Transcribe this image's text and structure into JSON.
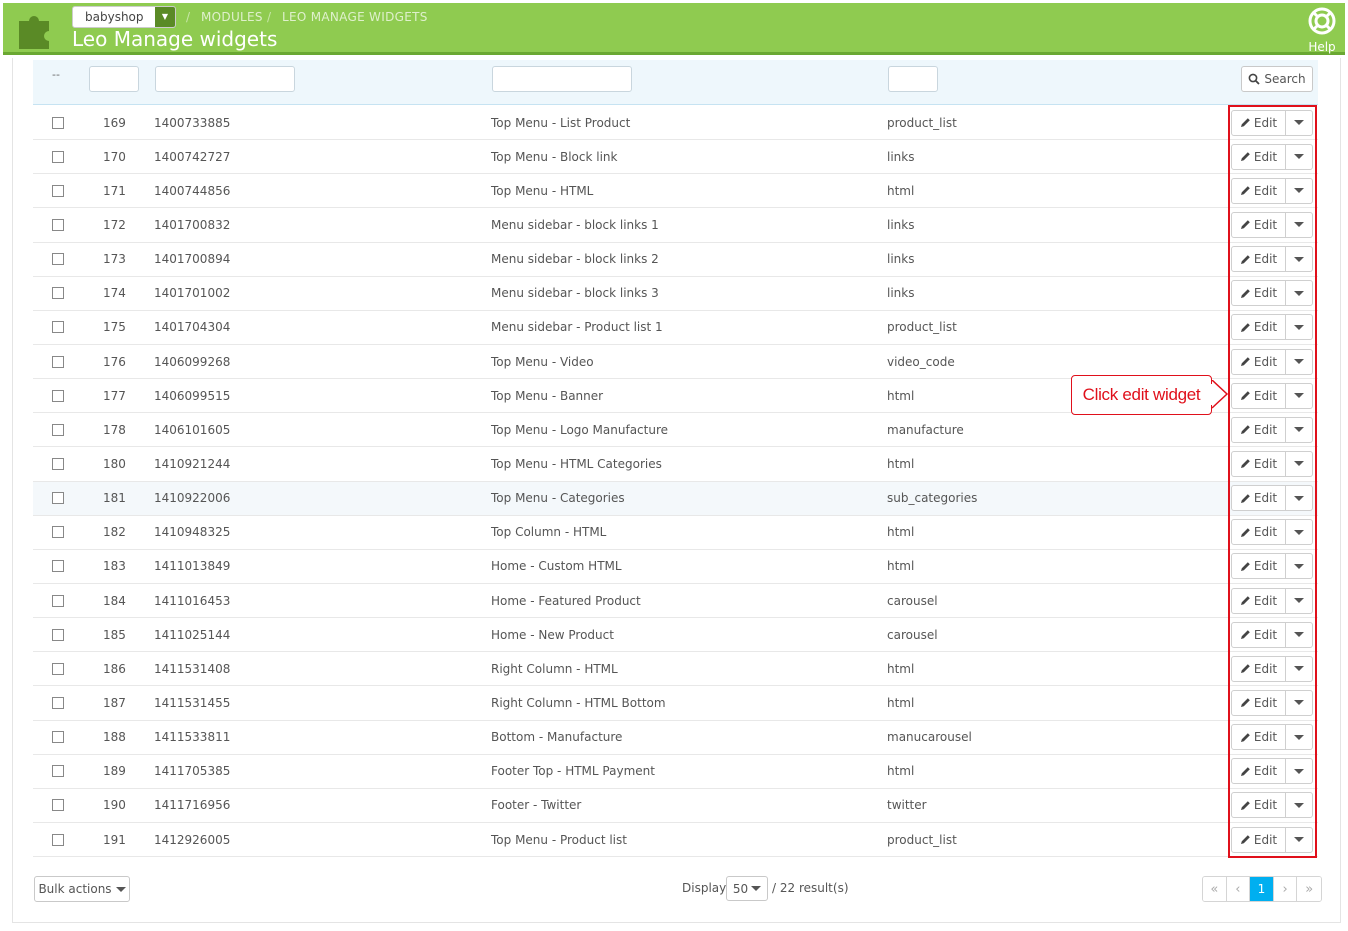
{
  "header": {
    "shop": "babyshop",
    "breadcrumb": [
      "MODULES",
      "LEO MANAGE WIDGETS"
    ],
    "title": "Leo Manage widgets",
    "help_label": "Help"
  },
  "filters": {
    "dash": "--",
    "search_label": "Search"
  },
  "rows": [
    {
      "id": "169",
      "key": "1400733885",
      "name": "Top Menu - List Product",
      "type": "product_list"
    },
    {
      "id": "170",
      "key": "1400742727",
      "name": "Top Menu - Block link",
      "type": "links"
    },
    {
      "id": "171",
      "key": "1400744856",
      "name": "Top Menu - HTML",
      "type": "html"
    },
    {
      "id": "172",
      "key": "1401700832",
      "name": "Menu sidebar - block links 1",
      "type": "links"
    },
    {
      "id": "173",
      "key": "1401700894",
      "name": "Menu sidebar - block links 2",
      "type": "links"
    },
    {
      "id": "174",
      "key": "1401701002",
      "name": "Menu sidebar - block links 3",
      "type": "links"
    },
    {
      "id": "175",
      "key": "1401704304",
      "name": "Menu sidebar - Product list 1",
      "type": "product_list"
    },
    {
      "id": "176",
      "key": "1406099268",
      "name": "Top Menu - Video",
      "type": "video_code"
    },
    {
      "id": "177",
      "key": "1406099515",
      "name": "Top Menu - Banner",
      "type": "html"
    },
    {
      "id": "178",
      "key": "1406101605",
      "name": "Top Menu - Logo Manufacture",
      "type": "manufacture"
    },
    {
      "id": "180",
      "key": "1410921244",
      "name": "Top Menu - HTML Categories",
      "type": "html"
    },
    {
      "id": "181",
      "key": "1410922006",
      "name": "Top Menu - Categories",
      "type": "sub_categories"
    },
    {
      "id": "182",
      "key": "1410948325",
      "name": "Top Column - HTML",
      "type": "html"
    },
    {
      "id": "183",
      "key": "1411013849",
      "name": "Home - Custom HTML",
      "type": "html"
    },
    {
      "id": "184",
      "key": "1411016453",
      "name": "Home - Featured Product",
      "type": "carousel"
    },
    {
      "id": "185",
      "key": "1411025144",
      "name": "Home - New Product",
      "type": "carousel"
    },
    {
      "id": "186",
      "key": "1411531408",
      "name": "Right Column - HTML",
      "type": "html"
    },
    {
      "id": "187",
      "key": "1411531455",
      "name": "Right Column - HTML Bottom",
      "type": "html"
    },
    {
      "id": "188",
      "key": "1411533811",
      "name": "Bottom - Manufacture",
      "type": "manucarousel"
    },
    {
      "id": "189",
      "key": "1411705385",
      "name": "Footer Top - HTML Payment",
      "type": "html"
    },
    {
      "id": "190",
      "key": "1411716956",
      "name": "Footer - Twitter",
      "type": "twitter"
    },
    {
      "id": "191",
      "key": "1412926005",
      "name": "Top Menu - Product list",
      "type": "product_list"
    }
  ],
  "row_edit_label": "Edit",
  "callout": "Click edit widget",
  "footer": {
    "bulk_label": "Bulk actions",
    "display_label": "Display",
    "per_page": "50",
    "results": "/ 22 result(s)",
    "current_page": "1"
  },
  "colors": {
    "header_green": "#8fcb50",
    "highlight_red": "#e0101b",
    "pager_active": "#00aff0"
  }
}
